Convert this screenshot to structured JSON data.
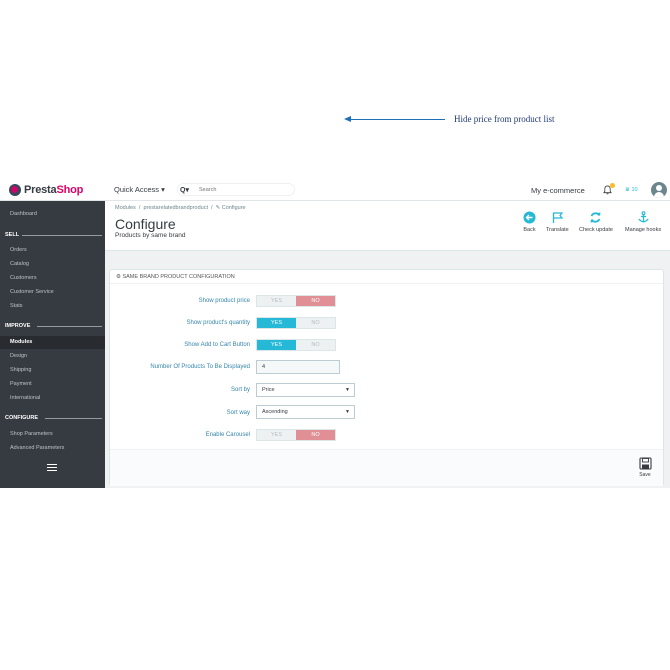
{
  "header": {
    "logo_prefix": "Presta",
    "logo_suffix": "Shop",
    "quick_access": "Quick Access ▾",
    "search_icon": "Q▾",
    "search_placeholder": "Search",
    "shop_name": "My e-commerce",
    "trophy_count": "10",
    "notification_icon": "bell-icon",
    "trophy_icon": "trophy-icon"
  },
  "sidebar": {
    "dashboard": "Dashboard",
    "sections": {
      "sell": "SELL",
      "improve": "IMPROVE",
      "configure": "CONFIGURE"
    },
    "sell_items": [
      "Orders",
      "Catalog",
      "Customers",
      "Customer Service",
      "Stats"
    ],
    "improve_items": [
      "Modules",
      "Design",
      "Shipping",
      "Payment",
      "International"
    ],
    "configure_items": [
      "Shop Parameters",
      "Advanced Parameters"
    ],
    "active_item": "Modules"
  },
  "page": {
    "breadcrumb_1": "Modules",
    "breadcrumb_sep": "/",
    "breadcrumb_2": "prestarelatedbrandproduct",
    "breadcrumb_3": "✎ Configure",
    "title": "Configure",
    "subtitle": "Products by same brand",
    "toolbar": {
      "back": "Back",
      "translate": "Translate",
      "check_update": "Check update",
      "manage_hooks": "Manage hooks"
    }
  },
  "panel": {
    "heading": "SAME BRAND PRODUCT CONFIGURATION",
    "yes": "YES",
    "no": "NO",
    "fields": {
      "show_price": {
        "label": "Show product price",
        "value": "NO"
      },
      "show_quantity": {
        "label": "Show product's quantity",
        "value": "YES"
      },
      "show_cart": {
        "label": "Show Add to Cart Button",
        "value": "YES"
      },
      "num_products": {
        "label": "Number Of Products To Be Displayed",
        "value": "4"
      },
      "sort_by": {
        "label": "Sort by",
        "value": "Price"
      },
      "sort_way": {
        "label": "Sort way",
        "value": "Ascending"
      },
      "carousel": {
        "label": "Enable Carousel",
        "value": "NO"
      }
    },
    "save_label": "Save"
  },
  "annotation": "Hide price from product list",
  "colors": {
    "accent": "#25b9d7",
    "no_active": "#e08f95",
    "sidebar": "#363a41",
    "brand": "#df0067",
    "annotation": "#1e6fb6"
  }
}
